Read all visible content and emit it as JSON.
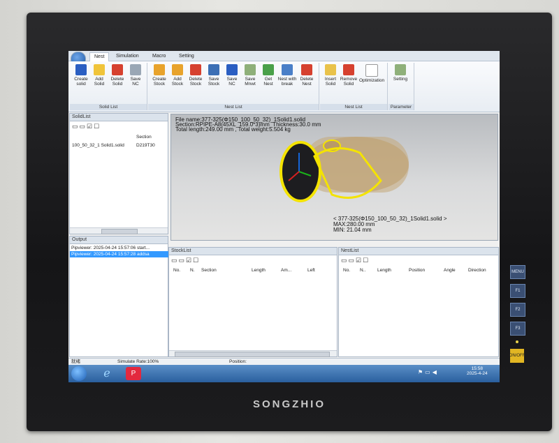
{
  "ribbon": {
    "tabs": [
      "Nest",
      "Simulation",
      "Macro",
      "Setting"
    ],
    "groups": [
      {
        "label": "Solid List",
        "buttons": [
          "Create\nsolid",
          "Add\nSolid",
          "Delete\nSolid",
          "Save\nNC"
        ]
      },
      {
        "label": "Nest List",
        "buttons": [
          "Create\nStock",
          "Add\nStock",
          "Delete\nStock",
          "Save\nStock",
          "Save\nNC",
          "Save\nMnwt",
          "Get\nNest",
          "Nest with\nbreak",
          "Delete\nNest"
        ]
      },
      {
        "label": "Nest List",
        "buttons": [
          "Insert\nSolid",
          "Remove\nSolid",
          "Optimization"
        ]
      },
      {
        "label": "Parameter",
        "buttons": [
          "Setting"
        ]
      }
    ]
  },
  "solidlist": {
    "title": "SolidList",
    "col_section": "Section",
    "row_name": "100_50_32_1 Solid1.solid",
    "row_section": "D219T30"
  },
  "output": {
    "title": "Output",
    "line1": "Pipviewer: 2025-04-24 15:57:06 start...",
    "line2": "Pipviewer: 2025-04-24 15:57:28 addsa"
  },
  "view": {
    "line1": "File name:377-325(Φ150_100_50_32)_1Solid1.solid",
    "line2": "Section:RPIPE-A8(45XL_159.0*3)mm_Thickness:30.0 mm",
    "line3": "Total length:249.00 mm , Total weight:5.504 kg",
    "info1": "< 377-325(Φ150_100_50_32)_1Solid1.solid >",
    "info2": "MAX:280.00 mm",
    "info3": "MIN: 21.04 mm"
  },
  "stocklist": {
    "title": "StockList",
    "columns": [
      "No.",
      "N.",
      "Section",
      "Length",
      "Am...",
      "Left"
    ]
  },
  "nestlist": {
    "title": "NestList",
    "columns": [
      "No.",
      "N..",
      "Length",
      "Position",
      "Angle",
      "Direction"
    ]
  },
  "status": {
    "ready": "就绪",
    "rate": "Simulate Rate:100%",
    "position": "Position:"
  },
  "taskbar": {
    "time": "15:58",
    "date": "2025-4-24"
  },
  "hardware": {
    "brand": "SONGZHIO",
    "buttons": [
      "MENU",
      "F1",
      "F2",
      "F3"
    ],
    "onoff": "ON/OFF"
  }
}
